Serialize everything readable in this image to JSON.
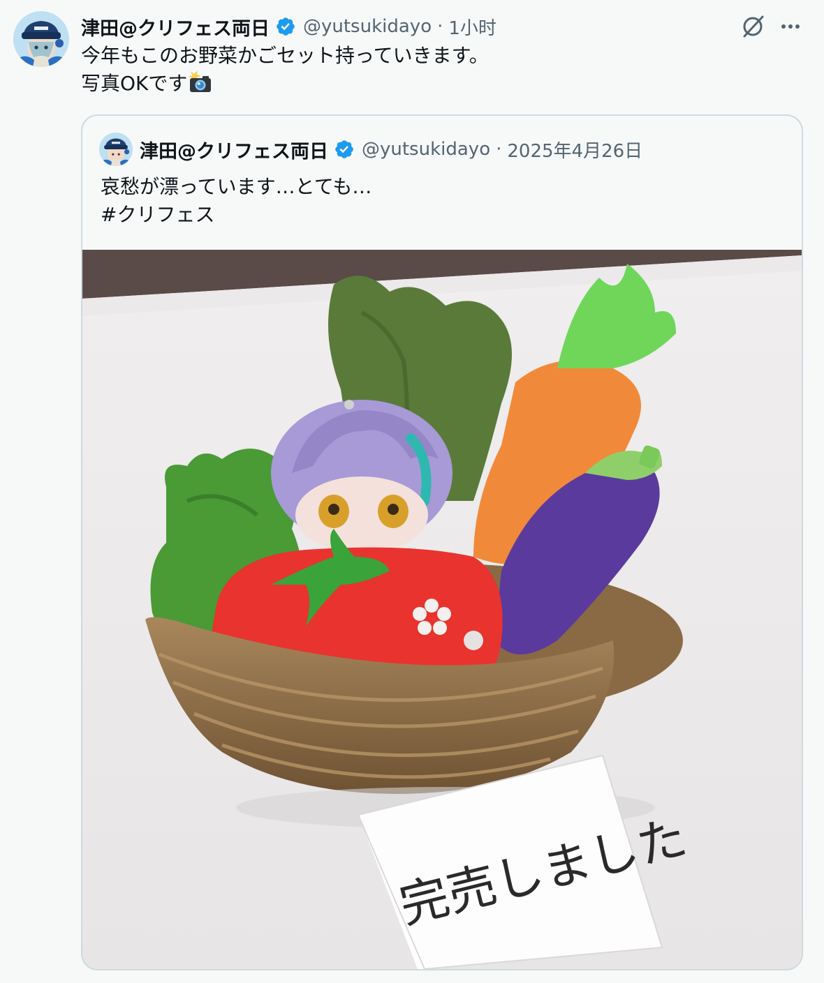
{
  "tweet": {
    "author_name": "津田@クリフェス両日",
    "handle": "@yutsukidayo",
    "separator": "·",
    "time": "1小时",
    "text_lines": [
      "今年もこのお野菜かごセット持っていきます。",
      "写真OKです"
    ],
    "camera_icon": "camera-flash-emoji-icon",
    "verified_icon": "verified-badge-icon",
    "verified_color": "#1d9bf0",
    "grok_icon": "grok-icon",
    "more_icon": "more-options-icon"
  },
  "quoted_tweet": {
    "author_name": "津田@クリフェス両日",
    "handle": "@yutsukidayo",
    "separator": "·",
    "date": "2025年4月26日",
    "text_lines": [
      "哀愁が漂っています…とても…",
      "#クリフェス"
    ],
    "photo": {
      "description_icon": "plush-vegetable-basket-photo",
      "sign_text": "完売しました"
    }
  },
  "colors": {
    "text_primary": "#0f1419",
    "text_secondary": "#536471",
    "border": "#cfd9de",
    "background": "#f7f9f9"
  }
}
